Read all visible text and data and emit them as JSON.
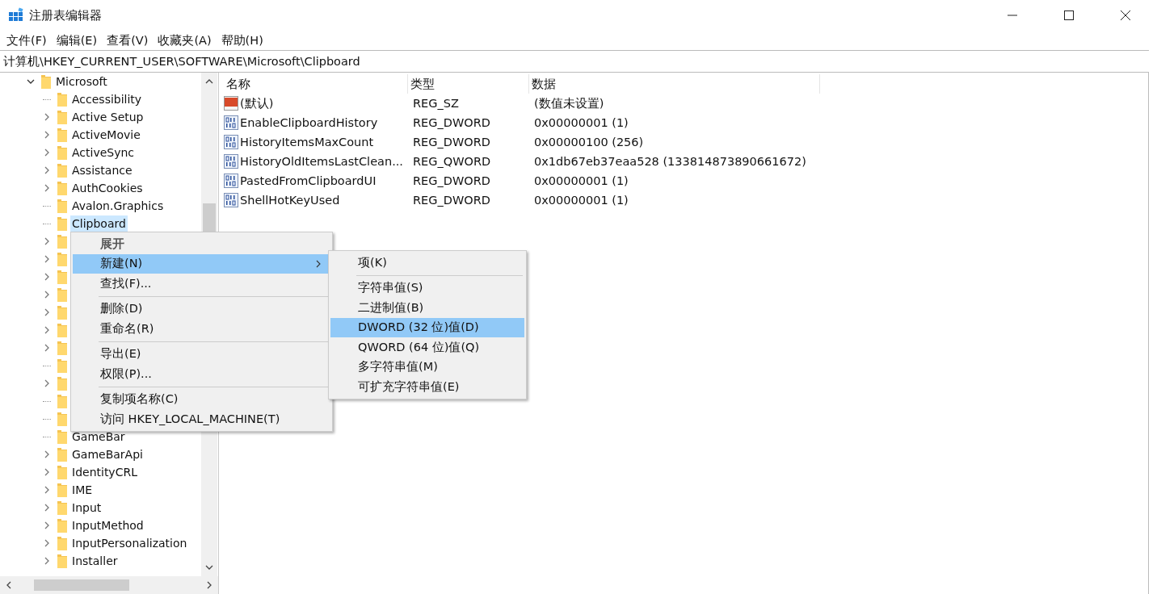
{
  "window": {
    "title": "注册表编辑器"
  },
  "menu": [
    "文件(F)",
    "编辑(E)",
    "查看(V)",
    "收藏夹(A)",
    "帮助(H)"
  ],
  "address": "计算机\\HKEY_CURRENT_USER\\SOFTWARE\\Microsoft\\Clipboard",
  "tree": {
    "label": "Microsoft",
    "expanded": true,
    "children": [
      {
        "label": "Accessibility",
        "expandable": false,
        "selected": false
      },
      {
        "label": "Active Setup",
        "expandable": true,
        "selected": false
      },
      {
        "label": "ActiveMovie",
        "expandable": true,
        "selected": false
      },
      {
        "label": "ActiveSync",
        "expandable": true,
        "selected": false
      },
      {
        "label": "Assistance",
        "expandable": true,
        "selected": false
      },
      {
        "label": "AuthCookies",
        "expandable": true,
        "selected": false
      },
      {
        "label": "Avalon.Graphics",
        "expandable": false,
        "selected": false
      },
      {
        "label": "Clipboard",
        "expandable": false,
        "selected": true
      },
      {
        "expandable": true
      },
      {
        "expandable": true
      },
      {
        "expandable": true
      },
      {
        "expandable": true
      },
      {
        "expandable": true
      },
      {
        "expandable": true
      },
      {
        "expandable": true
      },
      {
        "expandable": false
      },
      {
        "expandable": true
      },
      {
        "expandable": false
      },
      {
        "expandable": false
      },
      {
        "label": "GameBar",
        "expandable": false,
        "selected": false
      },
      {
        "label": "GameBarApi",
        "expandable": true,
        "selected": false
      },
      {
        "label": "IdentityCRL",
        "expandable": true,
        "selected": false
      },
      {
        "label": "IME",
        "expandable": true,
        "selected": false
      },
      {
        "label": "Input",
        "expandable": true,
        "selected": false
      },
      {
        "label": "InputMethod",
        "expandable": true,
        "selected": false
      },
      {
        "label": "InputPersonalization",
        "expandable": true,
        "selected": false
      },
      {
        "label": "Installer",
        "expandable": true,
        "selected": false
      }
    ]
  },
  "values": {
    "columns": [
      "名称",
      "类型",
      "数据"
    ],
    "rows": [
      {
        "kind": "string",
        "name": "(默认)",
        "type": "REG_SZ",
        "data": "(数值未设置)"
      },
      {
        "kind": "binary",
        "name": "EnableClipboardHistory",
        "type": "REG_DWORD",
        "data": "0x00000001 (1)"
      },
      {
        "kind": "binary",
        "name": "HistoryItemsMaxCount",
        "type": "REG_DWORD",
        "data": "0x00000100 (256)"
      },
      {
        "kind": "binary",
        "name": "HistoryOldItemsLastClean...",
        "type": "REG_QWORD",
        "data": "0x1db67eb37eaa528 (133814873890661672)"
      },
      {
        "kind": "binary",
        "name": "PastedFromClipboardUI",
        "type": "REG_DWORD",
        "data": "0x00000001 (1)"
      },
      {
        "kind": "binary",
        "name": "ShellHotKeyUsed",
        "type": "REG_DWORD",
        "data": "0x00000001 (1)"
      }
    ]
  },
  "context_menu": {
    "items": [
      {
        "kind": "header",
        "label": "展开"
      },
      {
        "kind": "submenu",
        "label": "新建(N)",
        "selected": true
      },
      {
        "kind": "item",
        "label": "查找(F)...",
        "selected": false
      },
      {
        "kind": "separator"
      },
      {
        "kind": "item",
        "label": "删除(D)",
        "selected": false
      },
      {
        "kind": "item",
        "label": "重命名(R)",
        "selected": false
      },
      {
        "kind": "separator"
      },
      {
        "kind": "item",
        "label": "导出(E)",
        "selected": false
      },
      {
        "kind": "item",
        "label": "权限(P)...",
        "selected": false
      },
      {
        "kind": "separator"
      },
      {
        "kind": "item",
        "label": "复制项名称(C)",
        "selected": false
      },
      {
        "kind": "item",
        "label": "访问 HKEY_LOCAL_MACHINE(T)",
        "selected": false
      }
    ]
  },
  "submenu": {
    "items": [
      {
        "kind": "item",
        "label": "项(K)",
        "selected": false
      },
      {
        "kind": "separator"
      },
      {
        "kind": "item",
        "label": "字符串值(S)",
        "selected": false
      },
      {
        "kind": "item",
        "label": "二进制值(B)",
        "selected": false
      },
      {
        "kind": "item",
        "label": "DWORD (32 位)值(D)",
        "selected": true
      },
      {
        "kind": "item",
        "label": "QWORD (64 位)值(Q)",
        "selected": false
      },
      {
        "kind": "item",
        "label": "多字符串值(M)",
        "selected": false
      },
      {
        "kind": "item",
        "label": "可扩充字符串值(E)",
        "selected": false
      }
    ]
  }
}
